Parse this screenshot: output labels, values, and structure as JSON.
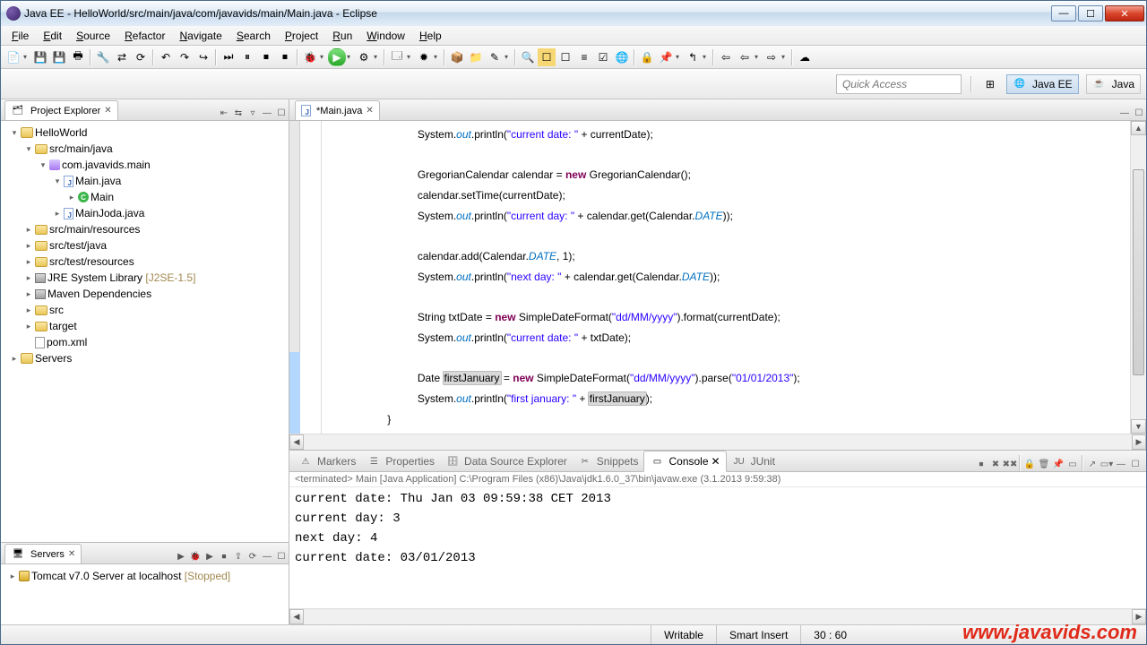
{
  "title": "Java EE - HelloWorld/src/main/java/com/javavids/main/Main.java - Eclipse",
  "menu": [
    "File",
    "Edit",
    "Source",
    "Refactor",
    "Navigate",
    "Search",
    "Project",
    "Run",
    "Window",
    "Help"
  ],
  "quick_access": "Quick Access",
  "perspectives": {
    "active": "Java EE",
    "other": "Java"
  },
  "project_explorer": {
    "title": "Project Explorer",
    "tree": {
      "root": "HelloWorld",
      "src_main_java": "src/main/java",
      "pkg": "com.javavids.main",
      "main_java": "Main.java",
      "main_cls": "Main",
      "main_joda": "MainJoda.java",
      "src_main_res": "src/main/resources",
      "src_test_java": "src/test/java",
      "src_test_res": "src/test/resources",
      "jre": "JRE System Library",
      "jre_v": "[J2SE-1.5]",
      "maven": "Maven Dependencies",
      "src": "src",
      "target": "target",
      "pom": "pom.xml",
      "servers_n": "Servers"
    }
  },
  "servers": {
    "title": "Servers",
    "item": "Tomcat v7.0 Server at localhost",
    "state": "[Stopped]"
  },
  "editor": {
    "tab": "*Main.java",
    "lines": [
      {
        "indent": 3,
        "tokens": [
          [
            "p",
            "System."
          ],
          [
            "st",
            "out"
          ],
          [
            "p",
            ".println("
          ],
          [
            "str",
            "\"current date: \""
          ],
          [
            "p",
            " + currentDate);"
          ]
        ]
      },
      {
        "indent": 0,
        "tokens": []
      },
      {
        "indent": 3,
        "tokens": [
          [
            "p",
            "GregorianCalendar calendar = "
          ],
          [
            "kw",
            "new"
          ],
          [
            "p",
            " GregorianCalendar();"
          ]
        ]
      },
      {
        "indent": 3,
        "tokens": [
          [
            "p",
            "calendar.setTime(currentDate);"
          ]
        ]
      },
      {
        "indent": 3,
        "tokens": [
          [
            "p",
            "System."
          ],
          [
            "st",
            "out"
          ],
          [
            "p",
            ".println("
          ],
          [
            "str",
            "\"current day: \""
          ],
          [
            "p",
            " + calendar.get(Calendar."
          ],
          [
            "st",
            "DATE"
          ],
          [
            "p",
            "));"
          ]
        ]
      },
      {
        "indent": 0,
        "tokens": []
      },
      {
        "indent": 3,
        "tokens": [
          [
            "p",
            "calendar.add(Calendar."
          ],
          [
            "st",
            "DATE"
          ],
          [
            "p",
            ", 1);"
          ]
        ]
      },
      {
        "indent": 3,
        "tokens": [
          [
            "p",
            "System."
          ],
          [
            "st",
            "out"
          ],
          [
            "p",
            ".println("
          ],
          [
            "str",
            "\"next day: \""
          ],
          [
            "p",
            " + calendar.get(Calendar."
          ],
          [
            "st",
            "DATE"
          ],
          [
            "p",
            "));"
          ]
        ]
      },
      {
        "indent": 0,
        "tokens": []
      },
      {
        "indent": 3,
        "tokens": [
          [
            "p",
            "String txtDate = "
          ],
          [
            "kw",
            "new"
          ],
          [
            "p",
            " SimpleDateFormat("
          ],
          [
            "str",
            "\"dd/MM/yyyy\""
          ],
          [
            "p",
            ").format(currentDate);"
          ]
        ]
      },
      {
        "indent": 3,
        "tokens": [
          [
            "p",
            "System."
          ],
          [
            "st",
            "out"
          ],
          [
            "p",
            ".println("
          ],
          [
            "str",
            "\"current date: \""
          ],
          [
            "p",
            " + txtDate);"
          ]
        ]
      },
      {
        "indent": 0,
        "tokens": []
      },
      {
        "indent": 3,
        "tokens": [
          [
            "p",
            "Date "
          ],
          [
            "hl",
            "firstJanuary"
          ],
          [
            "p",
            " = "
          ],
          [
            "kw",
            "new"
          ],
          [
            "p",
            " SimpleDateFormat("
          ],
          [
            "str",
            "\"dd/MM/yyyy\""
          ],
          [
            "p",
            ").parse("
          ],
          [
            "str",
            "\"01/01/2013\""
          ],
          [
            "p",
            ");"
          ]
        ]
      },
      {
        "indent": 3,
        "tokens": [
          [
            "p",
            "System."
          ],
          [
            "st",
            "out"
          ],
          [
            "p",
            ".println("
          ],
          [
            "str",
            "\"first january: \""
          ],
          [
            "p",
            " + "
          ],
          [
            "hl",
            "firstJanuary"
          ],
          [
            "p",
            ");"
          ]
        ]
      },
      {
        "indent": 2,
        "tokens": [
          [
            "p",
            "}"
          ]
        ]
      }
    ]
  },
  "bottom_tabs": [
    "Markers",
    "Properties",
    "Data Source Explorer",
    "Snippets",
    "Console",
    "JUnit"
  ],
  "console": {
    "header": "<terminated> Main [Java Application] C:\\Program Files (x86)\\Java\\jdk1.6.0_37\\bin\\javaw.exe (3.1.2013 9:59:38)",
    "out": "current date: Thu Jan 03 09:59:38 CET 2013\ncurrent day: 3\nnext day: 4\ncurrent date: 03/01/2013"
  },
  "status": {
    "writable": "Writable",
    "insert": "Smart Insert",
    "pos": "30 : 60"
  },
  "watermark": "www.javavids.com"
}
